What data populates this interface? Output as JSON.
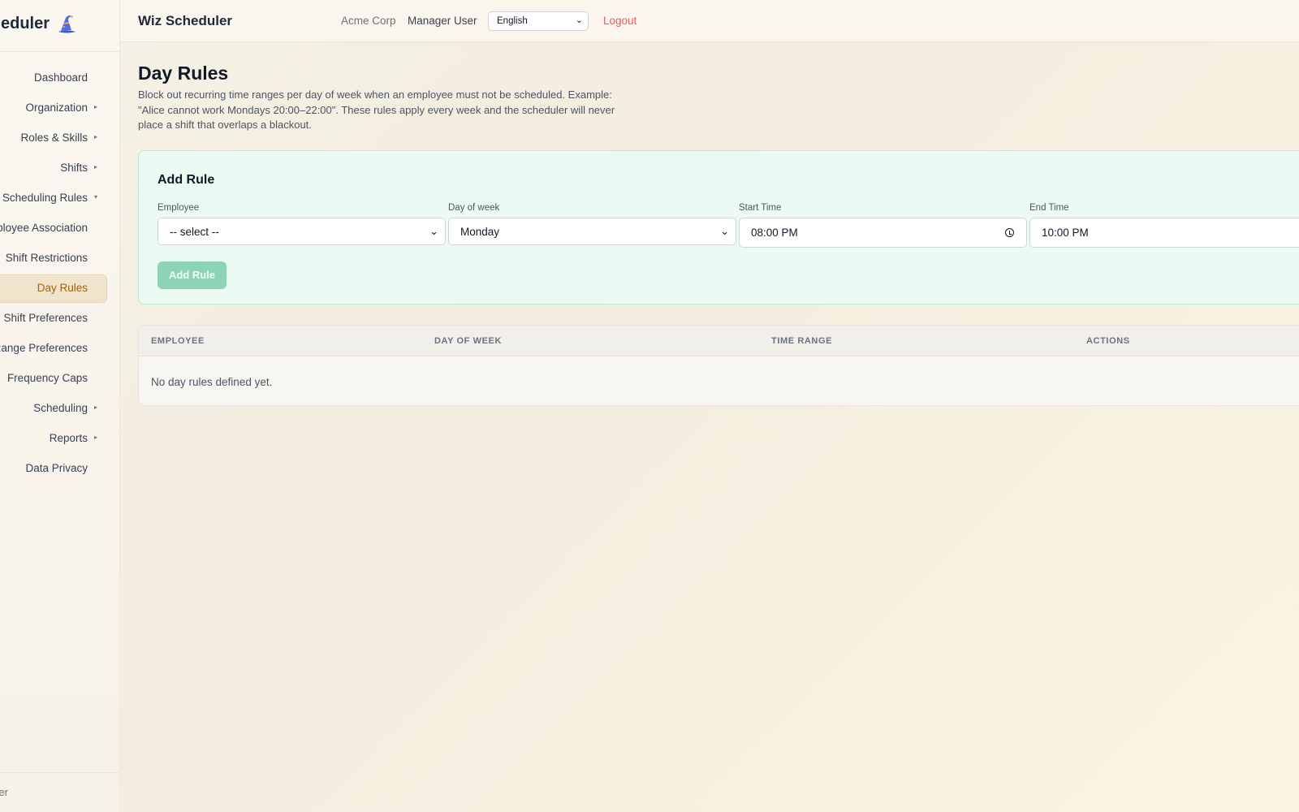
{
  "brand": {
    "name": "Wiz Scheduler"
  },
  "sidebar": {
    "items": [
      {
        "label": "Dashboard",
        "arrow": false,
        "active": false
      },
      {
        "label": "Organization",
        "arrow": true,
        "active": false
      },
      {
        "label": "Roles & Skills",
        "arrow": true,
        "active": false
      },
      {
        "label": "Shifts",
        "arrow": true,
        "active": false
      },
      {
        "label": "Scheduling Rules",
        "arrow": true,
        "active": false
      },
      {
        "label": "Employee Association",
        "arrow": false,
        "active": false
      },
      {
        "label": "Shift Restrictions",
        "arrow": false,
        "active": false
      },
      {
        "label": "Day Rules",
        "arrow": false,
        "active": true
      },
      {
        "label": "Shift Preferences",
        "arrow": false,
        "active": false
      },
      {
        "label": "Time Range Preferences",
        "arrow": false,
        "active": false
      },
      {
        "label": "Frequency Caps",
        "arrow": false,
        "active": false
      },
      {
        "label": "Scheduling",
        "arrow": true,
        "active": false
      },
      {
        "label": "Reports",
        "arrow": true,
        "active": false
      },
      {
        "label": "Data Privacy",
        "arrow": false,
        "active": false
      }
    ],
    "footer_label": "Manager"
  },
  "topbar": {
    "title": "Wiz Scheduler",
    "company": "Acme Corp",
    "user": "Manager User",
    "language": "English",
    "logout": "Logout"
  },
  "page": {
    "title": "Day Rules",
    "description": "Block out recurring time ranges per day of week when an employee must not be scheduled. Example: \"Alice cannot work Mondays 20:00–22:00\". These rules apply every week and the scheduler will never place a shift that overlaps a blackout."
  },
  "add_rule": {
    "title": "Add Rule",
    "employee_label": "Employee",
    "employee_value": "-- select --",
    "day_label": "Day of week",
    "day_value": "Monday",
    "start_label": "Start Time",
    "start_value": "08:00 PM",
    "end_label": "End Time",
    "end_value": "10:00 PM",
    "button": "Add Rule"
  },
  "table": {
    "columns": [
      "EMPLOYEE",
      "DAY OF WEEK",
      "TIME RANGE",
      "ACTIONS"
    ],
    "empty_message": "No day rules defined yet."
  },
  "colors": {
    "accent": "#8dd4b6",
    "logout": "#e0605c",
    "active_nav": "#a16207"
  }
}
